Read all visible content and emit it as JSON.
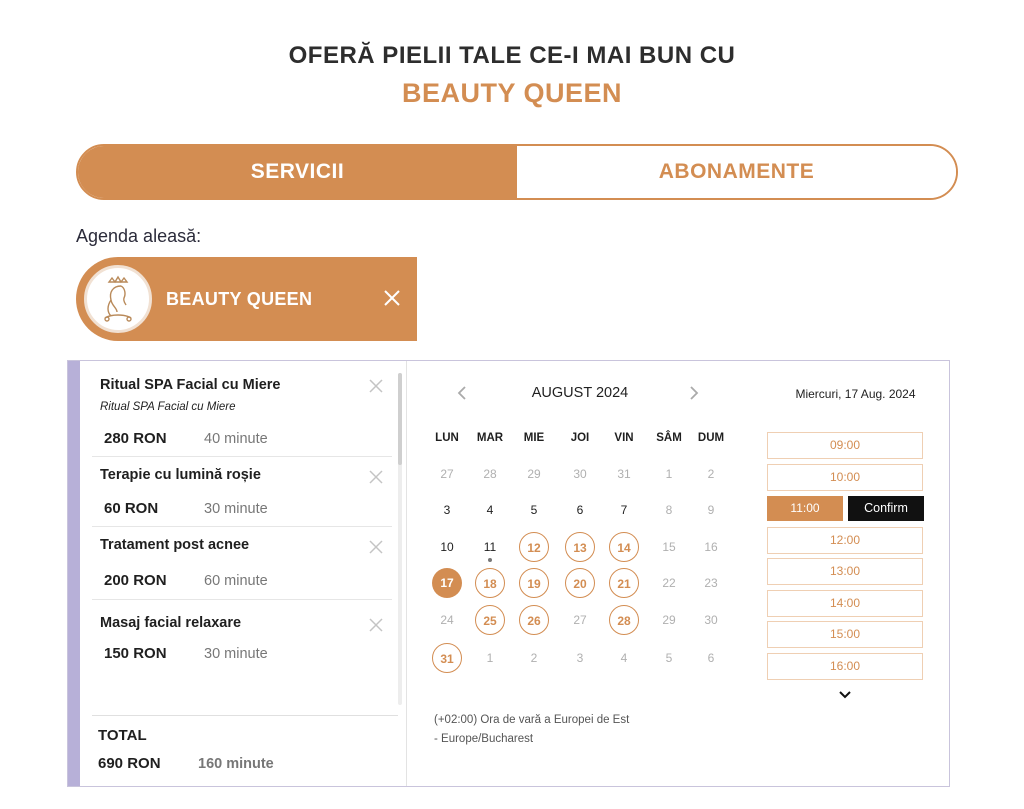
{
  "header": {
    "line1": "OFERĂ PIELII TALE CE-I MAI BUN CU",
    "line2": "BEAUTY QUEEN"
  },
  "tabs": [
    {
      "label": "SERVICII"
    },
    {
      "label": "ABONAMENTE"
    }
  ],
  "agenda": {
    "label": "Agenda aleasă:",
    "name": "BEAUTY QUEEN",
    "avatar_icon": "queen-logo-icon",
    "close_icon": "close-icon"
  },
  "services": [
    {
      "name": "Ritual SPA Facial cu Miere",
      "subtitle": "Ritual SPA Facial cu Miere",
      "price": "280 RON",
      "duration": "40 minute"
    },
    {
      "name": "Terapie cu lumină roșie",
      "price": "60 RON",
      "duration": "30 minute"
    },
    {
      "name": "Tratament post acnee",
      "price": "200 RON",
      "duration": "60 minute"
    },
    {
      "name": "Masaj facial relaxare",
      "price": "150 RON",
      "duration": "30 minute"
    }
  ],
  "total": {
    "label": "TOTAL",
    "price": "690 RON",
    "duration": "160 minute"
  },
  "calendar": {
    "month": "AUGUST 2024",
    "weekdays": [
      "LUN",
      "MAR",
      "MIE",
      "JOI",
      "VIN",
      "SÂM",
      "DUM"
    ],
    "weeks": [
      [
        {
          "d": "27",
          "s": "muted"
        },
        {
          "d": "28",
          "s": "muted"
        },
        {
          "d": "29",
          "s": "muted"
        },
        {
          "d": "30",
          "s": "muted"
        },
        {
          "d": "31",
          "s": "muted"
        },
        {
          "d": "1",
          "s": "muted"
        },
        {
          "d": "2",
          "s": "muted"
        }
      ],
      [
        {
          "d": "3",
          "s": "normal"
        },
        {
          "d": "4",
          "s": "normal"
        },
        {
          "d": "5",
          "s": "normal"
        },
        {
          "d": "6",
          "s": "normal"
        },
        {
          "d": "7",
          "s": "normal"
        },
        {
          "d": "8",
          "s": "muted"
        },
        {
          "d": "9",
          "s": "muted"
        }
      ],
      [
        {
          "d": "10",
          "s": "normal"
        },
        {
          "d": "11",
          "s": "today"
        },
        {
          "d": "12",
          "s": "available"
        },
        {
          "d": "13",
          "s": "available"
        },
        {
          "d": "14",
          "s": "available"
        },
        {
          "d": "15",
          "s": "muted"
        },
        {
          "d": "16",
          "s": "muted"
        }
      ],
      [
        {
          "d": "17",
          "s": "selected"
        },
        {
          "d": "18",
          "s": "available"
        },
        {
          "d": "19",
          "s": "available"
        },
        {
          "d": "20",
          "s": "available"
        },
        {
          "d": "21",
          "s": "available"
        },
        {
          "d": "22",
          "s": "muted"
        },
        {
          "d": "23",
          "s": "muted"
        }
      ],
      [
        {
          "d": "24",
          "s": "muted"
        },
        {
          "d": "25",
          "s": "available"
        },
        {
          "d": "26",
          "s": "available"
        },
        {
          "d": "27",
          "s": "muted"
        },
        {
          "d": "28",
          "s": "available"
        },
        {
          "d": "29",
          "s": "muted"
        },
        {
          "d": "30",
          "s": "muted"
        }
      ],
      [
        {
          "d": "31",
          "s": "available"
        },
        {
          "d": "1",
          "s": "muted"
        },
        {
          "d": "2",
          "s": "muted"
        },
        {
          "d": "3",
          "s": "muted"
        },
        {
          "d": "4",
          "s": "muted"
        },
        {
          "d": "5",
          "s": "muted"
        },
        {
          "d": "6",
          "s": "muted"
        }
      ]
    ],
    "timezone_line1": "(+02:00) Ora de vară a Europei de Est",
    "timezone_line2": "- Europe/Bucharest"
  },
  "schedule": {
    "date": "Miercuri, 17 Aug. 2024",
    "slots": [
      "09:00",
      "10:00",
      "11:00",
      "12:00",
      "13:00",
      "14:00",
      "15:00",
      "16:00"
    ],
    "selected_slot": "11:00",
    "confirm_label": "Confirm"
  },
  "colors": {
    "accent": "#d38d52",
    "panel_accent": "#b7b0d8",
    "dark": "#111111"
  }
}
